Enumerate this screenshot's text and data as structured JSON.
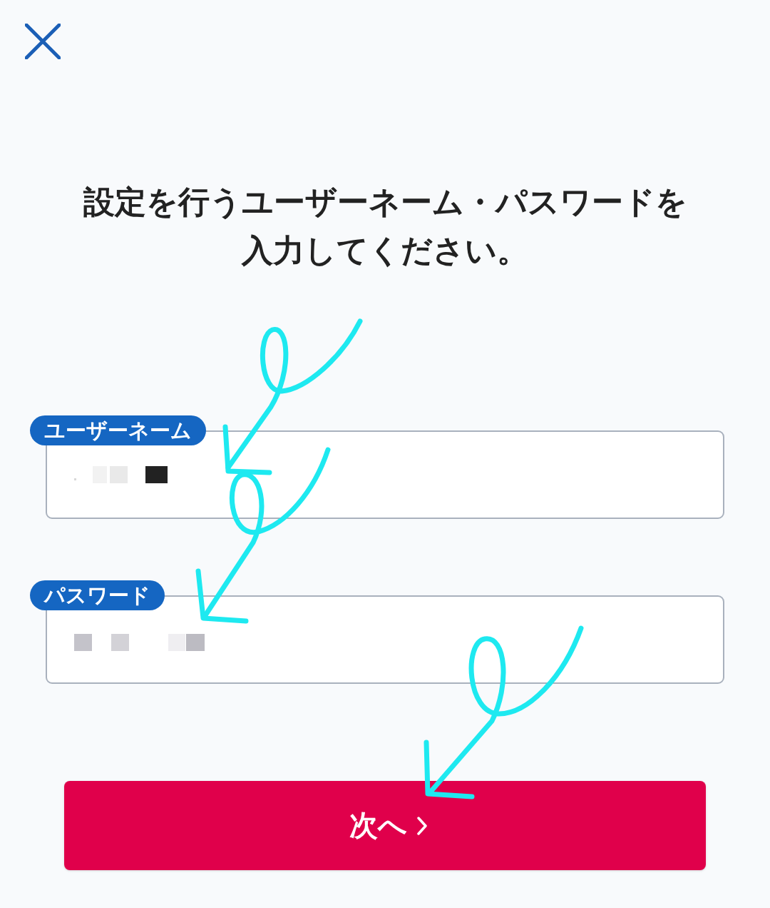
{
  "heading": "設定を行うユーザーネーム・パスワードを入力してください。",
  "fields": [
    {
      "kind": "username",
      "label": "ユーザーネーム",
      "redacted": true
    },
    {
      "kind": "password",
      "label": "パスワード",
      "redacted": true
    }
  ],
  "next_button": {
    "label": "次へ"
  }
}
